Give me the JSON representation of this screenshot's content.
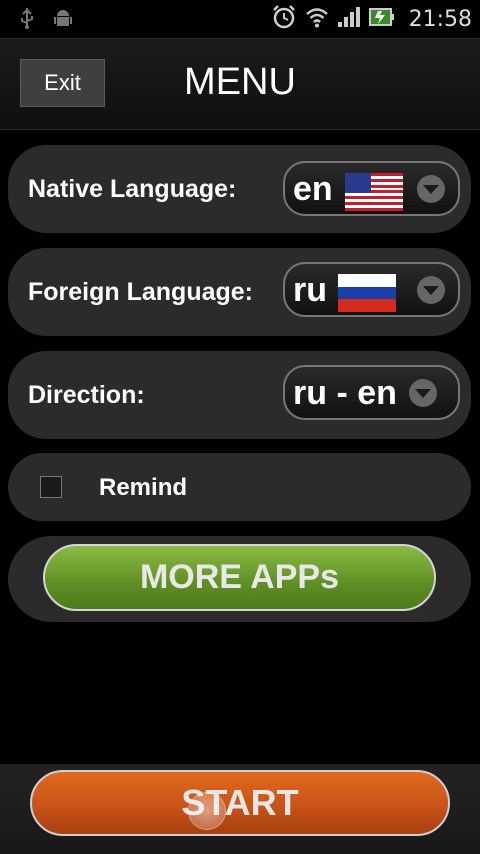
{
  "status_bar": {
    "time": "21:58",
    "icons": [
      "usb-icon",
      "android-debug-icon",
      "alarm-icon",
      "wifi-icon",
      "signal-icon",
      "battery-charging-icon"
    ]
  },
  "header": {
    "exit_label": "Exit",
    "title": "MENU"
  },
  "settings": {
    "native_language": {
      "label": "Native Language:",
      "value": "en",
      "flag": "us-flag-icon"
    },
    "foreign_language": {
      "label": "Foreign Language:",
      "value": "ru",
      "flag": "russia-flag-icon"
    },
    "direction": {
      "label": "Direction:",
      "value": "ru - en"
    },
    "remind": {
      "label": "Remind",
      "checked": false
    }
  },
  "buttons": {
    "more_apps": "MORE APPs",
    "start": "START"
  },
  "colors": {
    "more_apps_green": "#6e9e2c",
    "start_orange": "#d45e1b",
    "row_bg": "#2b2b2b"
  }
}
